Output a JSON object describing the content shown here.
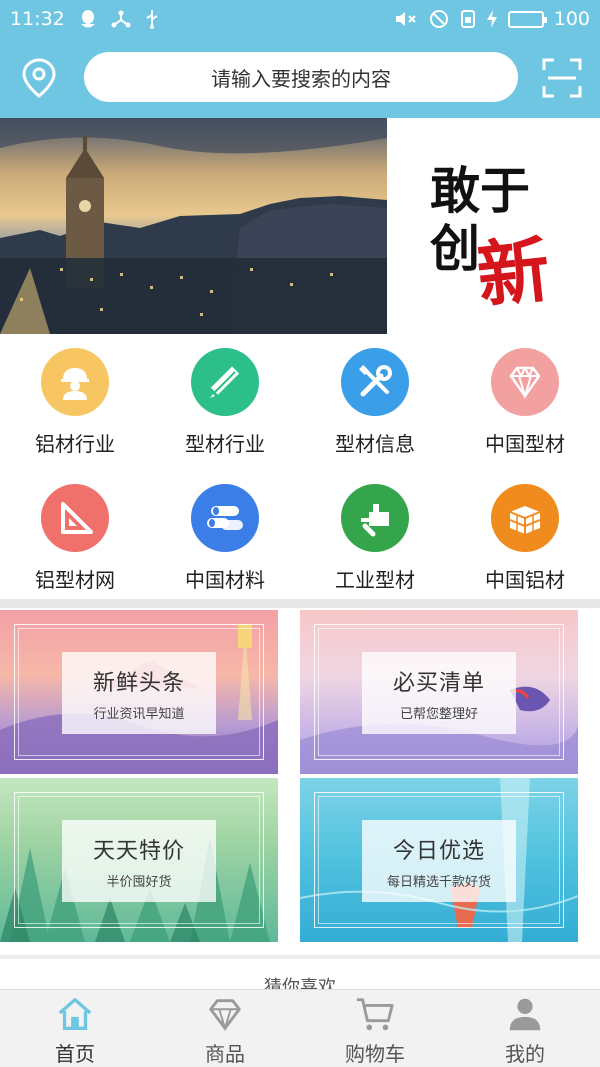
{
  "status": {
    "time": "11:32",
    "battery": "100"
  },
  "search": {
    "placeholder": "请输入要搜索的内容"
  },
  "banner": {
    "slogan_line1": "敢于",
    "slogan_line2": "创",
    "slogan_highlight": "新",
    "slides": 3
  },
  "categories": [
    {
      "label": "铝材行业",
      "icon": "worker-icon",
      "color": "#f7c663"
    },
    {
      "label": "型材行业",
      "icon": "ruler-pencil-icon",
      "color": "#2dbf8a"
    },
    {
      "label": "型材信息",
      "icon": "tools-icon",
      "color": "#3a9ee8"
    },
    {
      "label": "中国型材",
      "icon": "diamond-icon",
      "color": "#f3a0a0"
    },
    {
      "label": "铝型材网",
      "icon": "triangle-ruler-icon",
      "color": "#f0706c"
    },
    {
      "label": "中国材料",
      "icon": "pipes-icon",
      "color": "#3b7ee8"
    },
    {
      "label": "工业型材",
      "icon": "drill-icon",
      "color": "#34a54a"
    },
    {
      "label": "中国铝材",
      "icon": "bricks-icon",
      "color": "#f08c1e"
    }
  ],
  "promos": [
    {
      "title": "新鲜头条",
      "subtitle": "行业资讯早知道"
    },
    {
      "title": "必买清单",
      "subtitle": "已帮您整理好"
    },
    {
      "title": "天天特价",
      "subtitle": "半价囤好货"
    },
    {
      "title": "今日优选",
      "subtitle": "每日精选千款好货"
    }
  ],
  "guess": {
    "label": "猜你喜欢"
  },
  "tabs": [
    {
      "label": "首页",
      "icon": "home-icon",
      "active": true
    },
    {
      "label": "商品",
      "icon": "diamond-outline-icon",
      "active": false
    },
    {
      "label": "购物车",
      "icon": "cart-icon",
      "active": false
    },
    {
      "label": "我的",
      "icon": "person-icon",
      "active": false
    }
  ],
  "colors": {
    "accent": "#6ec6e3",
    "active_tab": "#6ec6e3",
    "inactive_tab": "#9a9a9a",
    "slogan_red": "#d4161c"
  }
}
